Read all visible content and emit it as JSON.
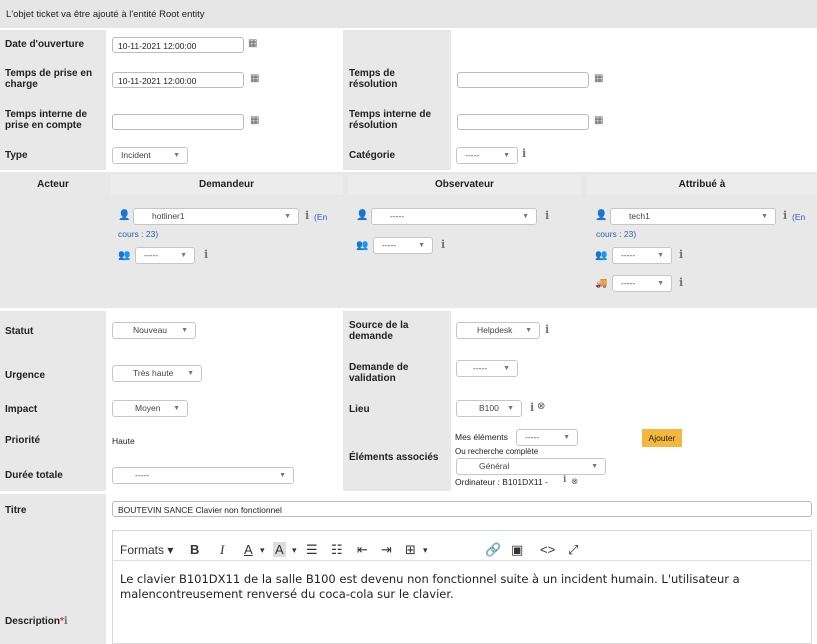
{
  "header": {
    "message": "L'objet ticket va être ajouté à l'entité Root entity"
  },
  "dates": {
    "opening_label": "Date d'ouverture",
    "opening_value": "10-11-2021 12:00:00",
    "takeover_time_label": "Temps de prise en charge",
    "takeover_time_value": "10-11-2021 12:00:00",
    "resolution_time_label": "Temps de résolution",
    "resolution_time_value": "",
    "internal_takeover_label": "Temps interne de prise en compte",
    "internal_takeover_value": "",
    "internal_resolution_label": "Temps interne de résolution",
    "internal_resolution_value": ""
  },
  "classification": {
    "type_label": "Type",
    "type_value": "Incident",
    "category_label": "Catégorie",
    "category_value": "-----"
  },
  "actors": {
    "actor_label": "Acteur",
    "requester_header": "Demandeur",
    "observer_header": "Observateur",
    "assigned_header": "Attribué à",
    "requester_user": "hotliner1",
    "requester_info_1": "(En",
    "requester_info_2": "cours : 23)",
    "requester_group": "-----",
    "observer_user": "-----",
    "observer_group": "-----",
    "assigned_user": "tech1",
    "assigned_info_1": "(En",
    "assigned_info_2": "cours : 23)",
    "assigned_group": "-----",
    "assigned_supplier": "-----"
  },
  "status": {
    "status_label": "Statut",
    "status_value": "Nouveau",
    "source_label": "Source de la demande",
    "source_value": "Helpdesk",
    "urgency_label": "Urgence",
    "urgency_value": "Très haute",
    "validation_label": "Demande de validation",
    "validation_value": "-----",
    "impact_label": "Impact",
    "impact_value": "Moyen",
    "location_label": "Lieu",
    "location_value": "B100",
    "priority_label": "Priorité",
    "priority_value": "Haute",
    "items_label": "Éléments associés",
    "my_items_label": "Mes éléments",
    "my_items_value": "-----",
    "add_button": "Ajouter",
    "full_search_label": "Ou recherche complète",
    "full_search_value": "Général",
    "item_linked": "Ordinateur : B101DX11 -",
    "duration_label": "Durée totale",
    "duration_value": "-----"
  },
  "content": {
    "title_label": "Titre",
    "title_value": "BOUTEVIN SANCE Clavier non fonctionnel",
    "description_label": "Description",
    "required_mark": "*",
    "formats_label": "Formats",
    "description_text": "Le clavier B101DX11 de la salle B100 est devenu non fonctionnel suite à un incident humain. L'utilisateur a malencontreusement renversé du coca-cola sur le clavier."
  },
  "colors": {
    "add_button_bg": "#f5b83d",
    "panel_grey": "#e8e8e8"
  }
}
